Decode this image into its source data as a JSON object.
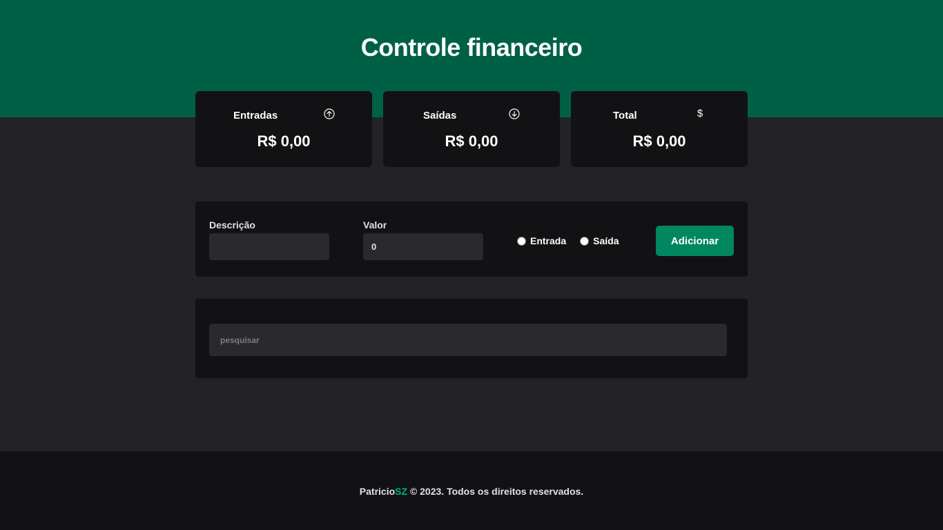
{
  "header": {
    "title": "Controle financeiro"
  },
  "summary": {
    "income": {
      "label": "Entradas",
      "value": "R$ 0,00",
      "icon": "arrow-circle-up-icon"
    },
    "expense": {
      "label": "Saídas",
      "value": "R$ 0,00",
      "icon": "arrow-circle-down-icon"
    },
    "total": {
      "label": "Total",
      "value": "R$ 0,00",
      "icon": "dollar-icon"
    }
  },
  "form": {
    "description_label": "Descrição",
    "description_value": "",
    "amount_label": "Valor",
    "amount_value": "0",
    "type_options": [
      "Entrada",
      "Saída"
    ],
    "submit_label": "Adicionar"
  },
  "search": {
    "placeholder": "pesquisar"
  },
  "footer": {
    "brand_primary": "Patricio",
    "brand_accent": "SZ",
    "rest": "© 2023. Todos os direitos reservados."
  },
  "colors": {
    "header_bg": "#006045",
    "page_bg": "#232325",
    "card_bg": "#121214",
    "accent": "#00875f",
    "brand_accent": "#00b37e"
  }
}
